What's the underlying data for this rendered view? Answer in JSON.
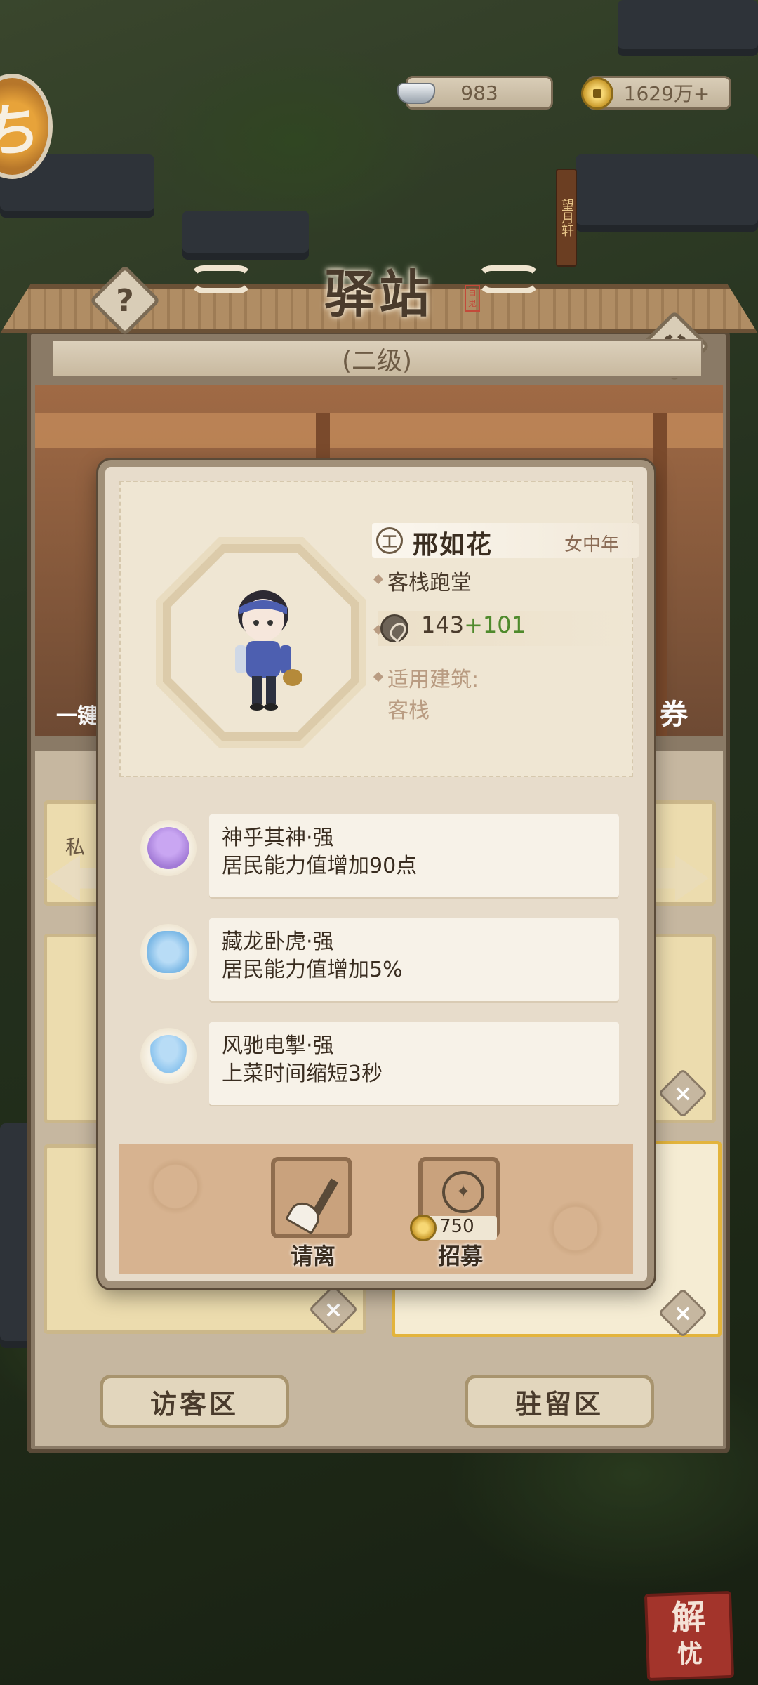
{
  "resources": {
    "silver": "983",
    "coins": "1629万+"
  },
  "corner_badge": "ち",
  "vertical_sign": "望月轩",
  "window": {
    "title": "驿站",
    "seal": "百鬼",
    "level": "(二级)",
    "side_left": "一键",
    "side_right": "券",
    "slot_label": "私塾"
  },
  "bottom_buttons": {
    "visitor": "访客区",
    "resident": "驻留区"
  },
  "card": {
    "name_icon": "工",
    "name": "邢如花",
    "tag": "女中年",
    "role": "客栈跑堂",
    "power": {
      "base": "143",
      "bonus": "+101"
    },
    "building_label": "适用建筑:",
    "building_value": "客栈",
    "skills": [
      {
        "icon": "buddha-icon",
        "title": "神乎其神·强",
        "desc": "居民能力值增加90点"
      },
      {
        "icon": "tiger-icon",
        "title": "藏龙卧虎·强",
        "desc": "居民能力值增加5%"
      },
      {
        "icon": "footprint-icon",
        "title": "风驰电掣·强",
        "desc": "上菜时间缩短3秒"
      }
    ],
    "actions": {
      "dismiss": "请离",
      "recruit": "招募",
      "recruit_cost": "750"
    }
  },
  "stamp": {
    "line1": "解",
    "line2": "忧"
  },
  "colors": {
    "accent_green": "#4f8a2c",
    "panel": "#e7dccb",
    "wood": "#8a7a66",
    "stamp_red": "#a3342b"
  }
}
